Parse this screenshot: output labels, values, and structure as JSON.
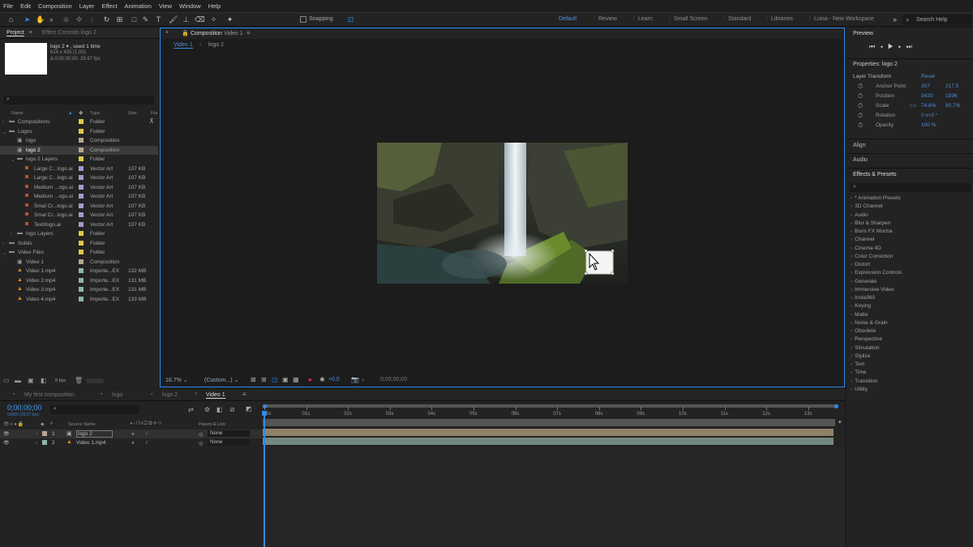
{
  "menu": [
    "File",
    "Edit",
    "Composition",
    "Layer",
    "Effect",
    "Animation",
    "View",
    "Window",
    "Help"
  ],
  "toolbar": {
    "snapping_label": "Snapping",
    "workspaces": [
      "Default",
      "Review",
      "Learn",
      "Small Screen",
      "Standard",
      "Libraries",
      "Luisa - New Workspace"
    ],
    "active_workspace": "Default",
    "search_placeholder": "Search Help"
  },
  "project": {
    "tabs": [
      "Project",
      "Effect Controls logo 2"
    ],
    "item_name": "logo 2 ▾ , used 1 time",
    "item_size": "614 x 435 (1.00)",
    "item_duration": "Δ 0;00;30;00, 29.97 fps",
    "columns": {
      "name": "Name",
      "type": "Type",
      "size": "Size",
      "fr": "Fra"
    },
    "rows": [
      {
        "name": "Compositions",
        "type": "Folder",
        "size": "",
        "color": "#e3c84a",
        "indent": 0,
        "kind": "folder"
      },
      {
        "name": "Logos",
        "type": "Folder",
        "size": "",
        "color": "#e3c84a",
        "indent": 0,
        "kind": "folder"
      },
      {
        "name": "logo",
        "type": "Composition",
        "size": "",
        "color": "#b5a88c",
        "indent": 1,
        "kind": "comp"
      },
      {
        "name": "logo 2",
        "type": "Composition",
        "size": "",
        "color": "#b5a88c",
        "indent": 1,
        "kind": "comp"
      },
      {
        "name": "logo 2 Layers",
        "type": "Folder",
        "size": "",
        "color": "#e3c84a",
        "indent": 1,
        "kind": "folder"
      },
      {
        "name": "Large C...logo.ai",
        "type": "Vector Art",
        "size": "107 KB",
        "color": "#a59ad0",
        "indent": 2,
        "kind": "ai"
      },
      {
        "name": "Large C...logo.ai",
        "type": "Vector Art",
        "size": "107 KB",
        "color": "#a59ad0",
        "indent": 2,
        "kind": "ai"
      },
      {
        "name": "Medium ...ogo.ai",
        "type": "Vector Art",
        "size": "107 KB",
        "color": "#a59ad0",
        "indent": 2,
        "kind": "ai"
      },
      {
        "name": "Medium ...ogo.ai",
        "type": "Vector Art",
        "size": "107 KB",
        "color": "#a59ad0",
        "indent": 2,
        "kind": "ai"
      },
      {
        "name": "Smal Cr...logo.ai",
        "type": "Vector Art",
        "size": "107 KB",
        "color": "#a59ad0",
        "indent": 2,
        "kind": "ai"
      },
      {
        "name": "Smal Cr...logo.ai",
        "type": "Vector Art",
        "size": "107 KB",
        "color": "#a59ad0",
        "indent": 2,
        "kind": "ai"
      },
      {
        "name": "Text/logo.ai",
        "type": "Vector Art",
        "size": "107 KB",
        "color": "#a59ad0",
        "indent": 2,
        "kind": "ai"
      },
      {
        "name": "logo Layers",
        "type": "Folder",
        "size": "",
        "color": "#e3c84a",
        "indent": 1,
        "kind": "folder"
      },
      {
        "name": "Solids",
        "type": "Folder",
        "size": "",
        "color": "#e3c84a",
        "indent": 0,
        "kind": "folder"
      },
      {
        "name": "Video Files",
        "type": "Folder",
        "size": "",
        "color": "#e3c84a",
        "indent": 0,
        "kind": "folder"
      },
      {
        "name": "Video 1",
        "type": "Composition",
        "size": "",
        "color": "#b5a88c",
        "indent": 1,
        "kind": "comp"
      },
      {
        "name": "Video 1.mp4",
        "type": "Importe...EX",
        "size": "132 MB",
        "color": "#8fb5a5",
        "indent": 1,
        "kind": "vlc"
      },
      {
        "name": "Video 2.mp4",
        "type": "Importe...EX",
        "size": "131 MB",
        "color": "#8fb5a5",
        "indent": 1,
        "kind": "vlc"
      },
      {
        "name": "Video 3.mp4",
        "type": "Importe...EX",
        "size": "131 MB",
        "color": "#8fb5a5",
        "indent": 1,
        "kind": "vlc"
      },
      {
        "name": "Video 4.mp4",
        "type": "Importe...EX",
        "size": "133 MB",
        "color": "#8fb5a5",
        "indent": 1,
        "kind": "vlc"
      }
    ],
    "bpc": "8 bpc"
  },
  "composition": {
    "tab_prefix": "Composition",
    "tab_name": "Video 1",
    "breadcrumbs": [
      "Video 1",
      "logo 2"
    ],
    "zoom": "16.7%",
    "resolution": "(Custom...)",
    "exposure": "+0.0",
    "timecode": "0;00;00;00"
  },
  "preview": {
    "title": "Preview"
  },
  "properties": {
    "title": "Properties: logo 2",
    "section": "Layer Transform",
    "reset": "Reset",
    "rows": [
      {
        "label": "Anchor Point",
        "v1": "307",
        "v2": "217.5"
      },
      {
        "label": "Position",
        "v1": "3420",
        "v2": "1836"
      },
      {
        "label": "Scale",
        "v1": "74.6%",
        "v2": "80.7%"
      },
      {
        "label": "Rotation",
        "v1": "0 x+0 °",
        "v2": ""
      },
      {
        "label": "Opacity",
        "v1": "100 %",
        "v2": ""
      }
    ]
  },
  "panels": [
    "Align",
    "Audio",
    "Effects & Presets"
  ],
  "effects": [
    "* Animation Presets",
    "3D Channel",
    "Audio",
    "Blur & Sharpen",
    "Boris FX Mocha",
    "Channel",
    "Cinema 4D",
    "Color Correction",
    "Distort",
    "Expression Controls",
    "Generate",
    "Immersive Video",
    "Insta360",
    "Keying",
    "Matte",
    "Noise & Grain",
    "Obsolete",
    "Perspective",
    "Simulation",
    "Stylize",
    "Text",
    "Time",
    "Transition",
    "Utility"
  ],
  "timeline": {
    "tabs": [
      "My first composition",
      "logo",
      "logo 2",
      "Video 1"
    ],
    "active_tab": "Video 1",
    "timecode": "0;00;00;00",
    "frame_info": "00000 (29.97 fps)",
    "col_source": "Source Name",
    "col_parent": "Parent & Link",
    "ruler": [
      "0s",
      "01s",
      "02s",
      "03s",
      "04s",
      "05s",
      "06s",
      "07s",
      "08s",
      "09s",
      "10s",
      "11s",
      "12s",
      "13s"
    ],
    "layers": [
      {
        "num": "1",
        "name": "logo 2",
        "parent": "None",
        "color": "#b5a88c",
        "bar": "#8f8268"
      },
      {
        "num": "2",
        "name": "Video 1.mp4",
        "parent": "None",
        "color": "#8fb5a5",
        "bar": "#73897f"
      }
    ]
  },
  "colors": {
    "accent": "#2d8ceb",
    "bg": "#1d1d1d"
  }
}
